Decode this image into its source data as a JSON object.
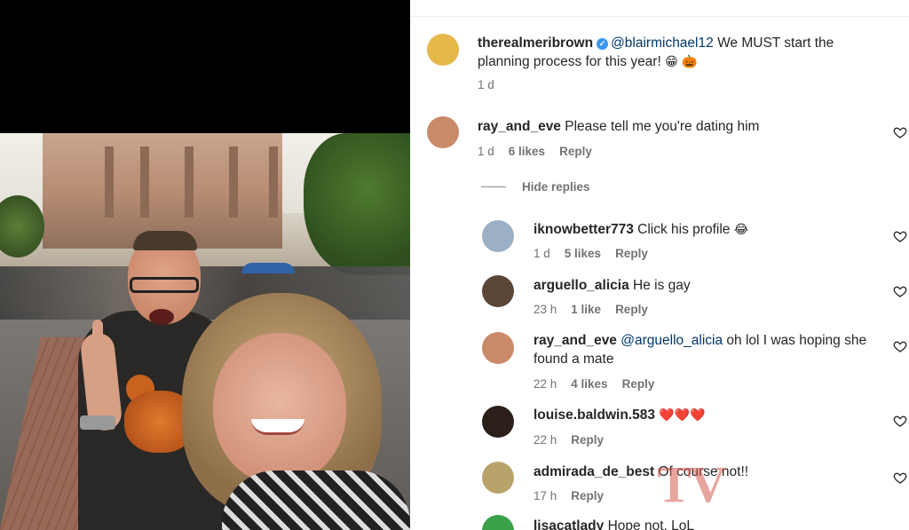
{
  "post_comments": [
    {
      "username": "therealmeribrown",
      "verified": true,
      "mention": "@blairmichael12",
      "text": "We MUST start the planning process for this year!",
      "emoji": "😁 🎃",
      "time": "1 d",
      "avatar_color": "#e6b84a"
    },
    {
      "username": "ray_and_eve",
      "text": "Please tell me you're dating him",
      "time": "1 d",
      "likes": "6 likes",
      "reply_label": "Reply",
      "avatar_color": "#c98a6a"
    }
  ],
  "hide_replies_label": "Hide replies",
  "replies": [
    {
      "username": "iknowbetter773",
      "text": "Click his profile",
      "emoji": "😂",
      "time": "1 d",
      "likes": "5 likes",
      "reply_label": "Reply",
      "avatar_color": "#9bb0c4"
    },
    {
      "username": "arguello_alicia",
      "text": "He is gay",
      "time": "23 h",
      "likes": "1 like",
      "reply_label": "Reply",
      "avatar_color": "#5a4636"
    },
    {
      "username": "ray_and_eve",
      "mention": "@arguello_alicia",
      "text": "oh lol I was hoping she found a mate",
      "time": "22 h",
      "likes": "4 likes",
      "reply_label": "Reply",
      "avatar_color": "#c98a6a"
    },
    {
      "username": "louise.baldwin.583",
      "emoji": "❤️❤️❤️",
      "time": "22 h",
      "reply_label": "Reply",
      "avatar_color": "#2b1f1a"
    },
    {
      "username": "admirada_de_best",
      "text": "Of course not!!",
      "time": "17 h",
      "reply_label": "Reply",
      "avatar_color": "#b8a36a"
    },
    {
      "username": "lisacatlady",
      "text": "Hope not. LoL",
      "avatar_color": "#3aa04a"
    }
  ],
  "watermark": "TV",
  "colors": {
    "mention": "#00376b",
    "meta": "#737373",
    "verified": "#3897f0"
  }
}
